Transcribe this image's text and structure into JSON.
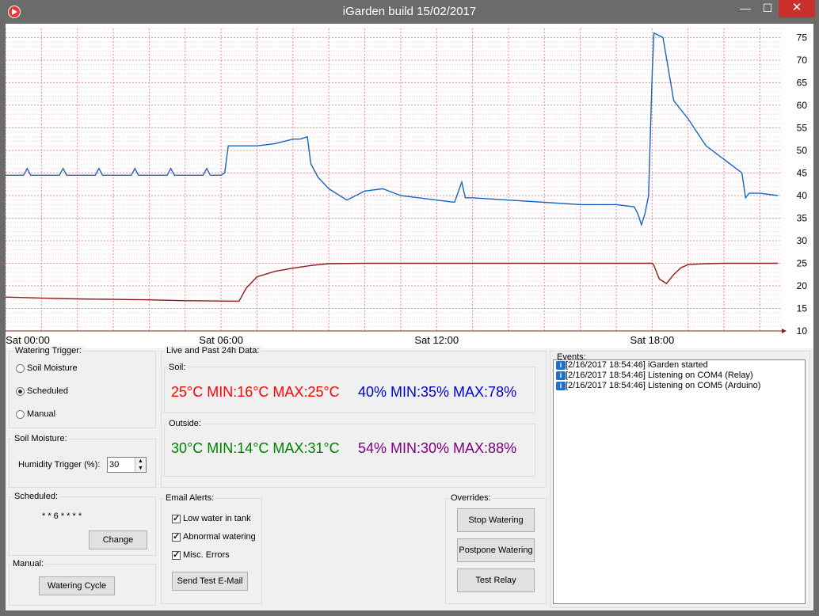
{
  "window": {
    "title": "iGarden build 15/02/2017",
    "min": "—",
    "max": "☐",
    "close": "✕"
  },
  "chart": {
    "y_ticks": [
      "75",
      "70",
      "65",
      "60",
      "55",
      "50",
      "45",
      "40",
      "35",
      "30",
      "25",
      "20",
      "15",
      "10"
    ],
    "x_ticks": [
      "Sat 00:00",
      "Sat 06:00",
      "Sat 12:00",
      "Sat 18:00"
    ]
  },
  "chart_data": {
    "type": "line",
    "xlabel": "",
    "ylabel": "",
    "x_ticks": [
      "Sat 00:00",
      "Sat 06:00",
      "Sat 12:00",
      "Sat 18:00"
    ],
    "ylim": [
      10,
      77
    ],
    "grid": true,
    "colors": {
      "series1": "#1565c0",
      "series2": "#8b1a1a",
      "grid": "#f4a6b0"
    },
    "series": [
      {
        "x": [
          0,
          0.5,
          0.6,
          0.7,
          1.0,
          1.5,
          1.6,
          1.7,
          2.0,
          2.5,
          2.6,
          2.7,
          3.0,
          3.5,
          3.6,
          3.7,
          4.0,
          4.5,
          4.6,
          4.7,
          5.0,
          5.5,
          5.6,
          5.7,
          6.0,
          6.1,
          6.2,
          6.4,
          7.0,
          7.5,
          8.0,
          8.2,
          8.4,
          8.5,
          8.7,
          9.0,
          9.5,
          10.0,
          10.5,
          11.0,
          11.5,
          12.0,
          12.5,
          12.7,
          12.8,
          13.0,
          14.0,
          15.0,
          16.0,
          17.0,
          17.5,
          17.6,
          17.7,
          17.8,
          17.9,
          18.0,
          18.05,
          18.3,
          18.6,
          19.0,
          19.5,
          20.0,
          20.5,
          20.6,
          20.7,
          21.0,
          21.5
        ],
        "values": [
          44.5,
          44.5,
          46,
          44.5,
          44.5,
          44.5,
          46,
          44.5,
          44.5,
          44.5,
          46,
          44.5,
          44.5,
          44.5,
          46,
          44.5,
          44.5,
          44.5,
          46,
          44.5,
          44.5,
          44.5,
          46,
          44.5,
          44.5,
          45,
          51,
          51,
          51,
          51.5,
          52.5,
          52.5,
          53,
          47,
          44,
          41.5,
          39,
          41,
          41.5,
          40,
          39.5,
          39,
          38.5,
          43,
          39.5,
          39.5,
          39,
          38.5,
          38,
          38,
          37.5,
          36,
          33.5,
          36,
          40,
          67,
          76,
          75,
          61,
          57,
          51,
          48,
          45,
          39.5,
          40.5,
          40.5,
          40
        ]
      },
      {
        "x": [
          0,
          1,
          2,
          3,
          4,
          5,
          6.5,
          6.7,
          7.0,
          7.5,
          8.0,
          8.5,
          9,
          10,
          11,
          12,
          13,
          14,
          15,
          16,
          17,
          18,
          18.05,
          18.2,
          18.4,
          18.6,
          18.8,
          19.0,
          19.5,
          20,
          21,
          21.5
        ],
        "values": [
          17.5,
          17.3,
          17.1,
          17.0,
          16.9,
          16.7,
          16.6,
          19.5,
          22,
          23.2,
          23.9,
          24.5,
          24.9,
          25,
          25,
          25,
          25,
          25,
          25,
          25,
          25,
          25,
          24.5,
          21.5,
          20.5,
          22.5,
          24,
          24.7,
          24.9,
          25,
          25,
          25
        ]
      }
    ]
  },
  "trigger": {
    "title": "Watering Trigger:",
    "options": [
      "Soil Moisture",
      "Scheduled",
      "Manual"
    ],
    "selected": "Scheduled"
  },
  "soil_moisture": {
    "title": "Soil Moisture:",
    "label": "Humidity Trigger (%):",
    "value": "30"
  },
  "scheduled": {
    "title": "Scheduled:",
    "cron": "* * 6 * * * *",
    "change": "Change"
  },
  "manual": {
    "title": "Manual:",
    "button": "Watering Cycle"
  },
  "live": {
    "title": "Live and Past 24h Data:",
    "soil": {
      "title": "Soil:",
      "temp": "25°C MIN:16°C MAX:25°C",
      "humidity": "40% MIN:35% MAX:78%",
      "temp_color": "#ff0000",
      "humidity_color": "#0000dd"
    },
    "outside": {
      "title": "Outside:",
      "temp": "30°C MIN:14°C MAX:31°C",
      "humidity": "54% MIN:30% MAX:88%",
      "temp_color": "#008000",
      "humidity_color": "#800080"
    }
  },
  "email": {
    "title": "Email Alerts:",
    "items": [
      {
        "label": "Low water in tank",
        "checked": true
      },
      {
        "label": "Abnormal watering",
        "checked": true
      },
      {
        "label": "Misc. Errors",
        "checked": true
      }
    ],
    "test_button": "Send Test E-Mail"
  },
  "overrides": {
    "title": "Overrides:",
    "buttons": [
      "Stop Watering",
      "Postpone Watering",
      "Test Relay"
    ]
  },
  "events": {
    "title": "Events:",
    "items": [
      "[2/16/2017 18:54:46] iGarden started",
      "[2/16/2017 18:54:46] Listening on COM4 (Relay)",
      "[2/16/2017 18:54:46] Listening on COM5 (Arduino)"
    ]
  }
}
